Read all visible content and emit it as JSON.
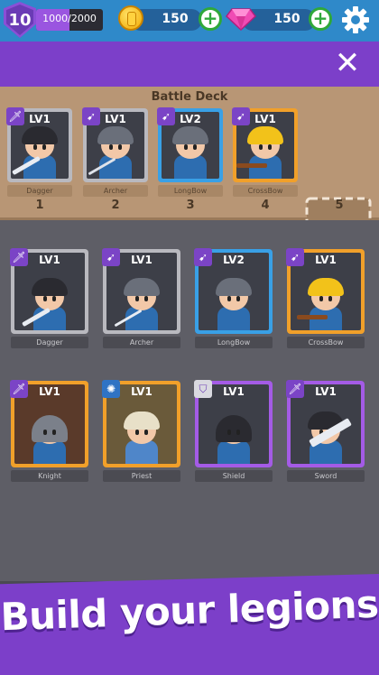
{
  "hud": {
    "level": "10",
    "xp_text": "1000/2000",
    "xp_fraction": 0.5,
    "coins": "150",
    "gems": "150",
    "icons": [
      "level-shield-icon",
      "coin-icon",
      "gem-icon",
      "plus-icon",
      "gear-icon"
    ]
  },
  "deck": {
    "title": "Battle Deck",
    "slots": [
      {
        "number": "1",
        "level": "LV1",
        "name": "Dagger",
        "frame": "gray",
        "badge": "sword"
      },
      {
        "number": "2",
        "level": "LV1",
        "name": "Archer",
        "frame": "gray",
        "badge": "bow"
      },
      {
        "number": "3",
        "level": "LV2",
        "name": "LongBow",
        "frame": "blue",
        "badge": "bow"
      },
      {
        "number": "4",
        "level": "LV1",
        "name": "CrossBow",
        "frame": "orange",
        "badge": "bow"
      },
      {
        "number": "5",
        "level": "",
        "name": "",
        "frame": "empty",
        "badge": ""
      }
    ]
  },
  "collection": [
    {
      "level": "LV1",
      "name": "Dagger",
      "frame": "gray",
      "badge": "sword"
    },
    {
      "level": "LV1",
      "name": "Archer",
      "frame": "gray",
      "badge": "bow"
    },
    {
      "level": "LV2",
      "name": "LongBow",
      "frame": "blue",
      "badge": "bow"
    },
    {
      "level": "LV1",
      "name": "CrossBow",
      "frame": "orange",
      "badge": "bow"
    },
    {
      "level": "LV1",
      "name": "Knight",
      "frame": "orange",
      "badge": "sword"
    },
    {
      "level": "LV1",
      "name": "Priest",
      "frame": "orange",
      "badge": "sun"
    },
    {
      "level": "LV1",
      "name": "Shield",
      "frame": "purple",
      "badge": "shield"
    },
    {
      "level": "LV1",
      "name": "Sword",
      "frame": "purple",
      "badge": "sword"
    }
  ],
  "banner": {
    "text": "Build your legions"
  },
  "colors": {
    "accent": "#7c3fc9",
    "hud": "#2f89c9",
    "deck": "#b89675"
  }
}
